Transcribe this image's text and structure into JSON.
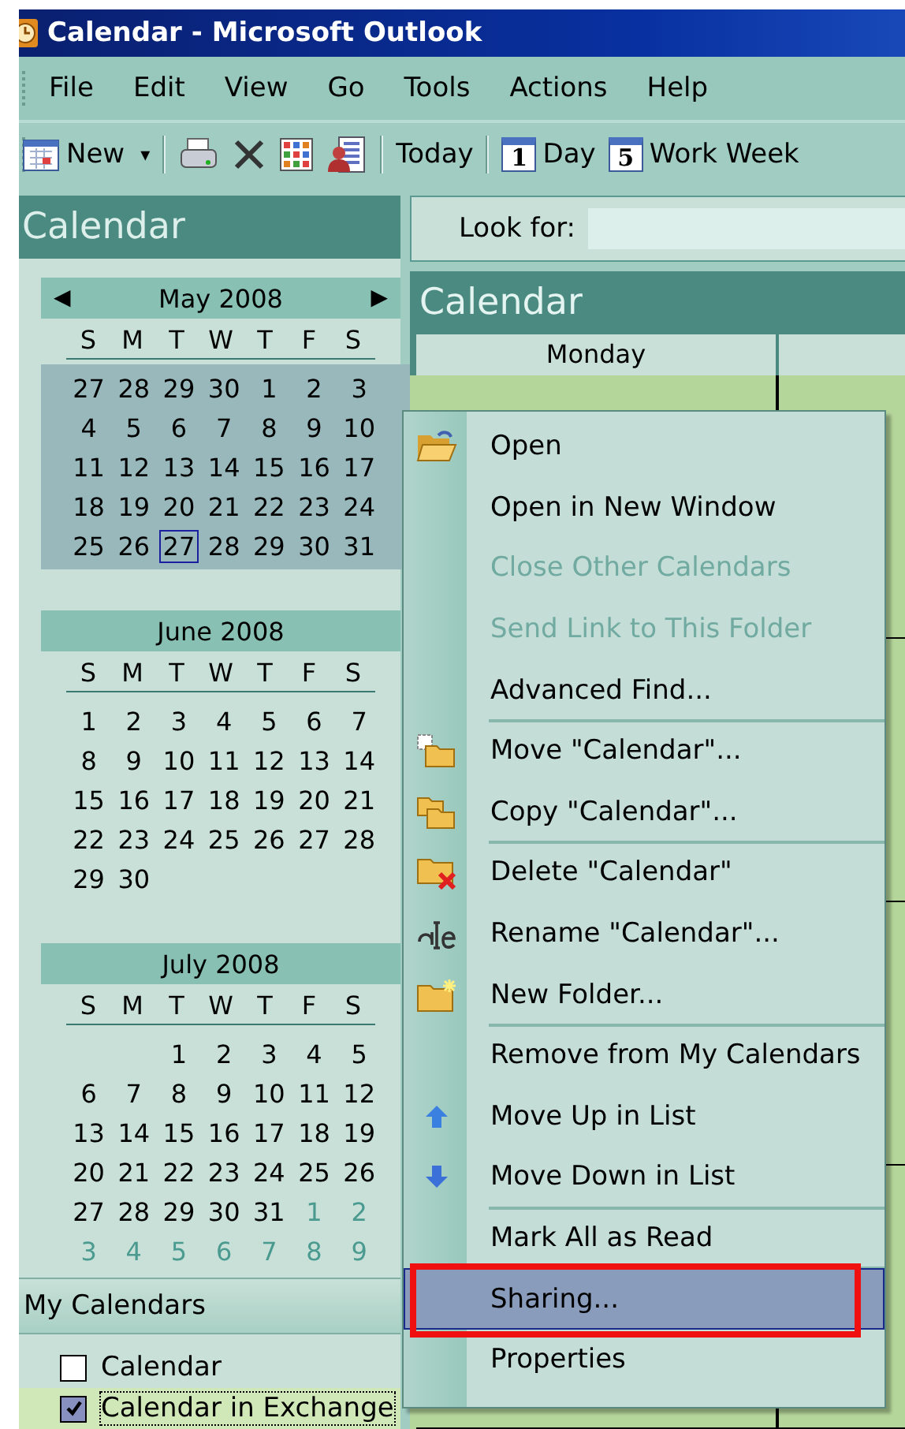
{
  "window": {
    "title": "Calendar - Microsoft Outlook"
  },
  "menu_bar": [
    "File",
    "Edit",
    "View",
    "Go",
    "Tools",
    "Actions",
    "Help"
  ],
  "toolbar": [
    {
      "kind": "new",
      "label": "New",
      "caret": "▾"
    },
    {
      "kind": "sep"
    },
    {
      "kind": "print"
    },
    {
      "kind": "delete"
    },
    {
      "kind": "grid"
    },
    {
      "kind": "contacts"
    },
    {
      "kind": "sep"
    },
    {
      "kind": "text",
      "label": "Today"
    },
    {
      "kind": "sep"
    },
    {
      "kind": "day",
      "glyph": "1",
      "label": "Day"
    },
    {
      "kind": "day",
      "glyph": "5",
      "label": "Work Week"
    }
  ],
  "navigation": {
    "title": "Calendar",
    "months": [
      {
        "title": "May 2008",
        "prev": "◀",
        "next": "▶",
        "selected": true,
        "weekdays": [
          "S",
          "M",
          "T",
          "W",
          "T",
          "F",
          "S"
        ],
        "weeks": [
          [
            "27",
            "28",
            "29",
            "30",
            "1",
            "2",
            "3"
          ],
          [
            "4",
            "5",
            "6",
            "7",
            "8",
            "9",
            "10"
          ],
          [
            "11",
            "12",
            "13",
            "14",
            "15",
            "16",
            "17"
          ],
          [
            "18",
            "19",
            "20",
            "21",
            "22",
            "23",
            "24"
          ],
          [
            "25",
            "26",
            {
              "d": "27",
              "today": true
            },
            "28",
            "29",
            "30",
            "31"
          ]
        ]
      },
      {
        "title": "June 2008",
        "selected": false,
        "weekdays": [
          "S",
          "M",
          "T",
          "W",
          "T",
          "F",
          "S"
        ],
        "weeks": [
          [
            "1",
            "2",
            "3",
            "4",
            "5",
            "6",
            "7"
          ],
          [
            "8",
            "9",
            "10",
            "11",
            "12",
            "13",
            "14"
          ],
          [
            "15",
            "16",
            "17",
            "18",
            "19",
            "20",
            "21"
          ],
          [
            "22",
            "23",
            "24",
            "25",
            "26",
            "27",
            "28"
          ],
          [
            "29",
            "30"
          ]
        ]
      },
      {
        "title": "July 2008",
        "selected": false,
        "weekdays": [
          "S",
          "M",
          "T",
          "W",
          "T",
          "F",
          "S"
        ],
        "weeks": [
          [
            "1",
            "2",
            "3",
            "4",
            "5"
          ],
          [
            "6",
            "7",
            "8",
            "9",
            "10",
            "11",
            "12"
          ],
          [
            "13",
            "14",
            "15",
            "16",
            "17",
            "18",
            "19"
          ],
          [
            "20",
            "21",
            "22",
            "23",
            "24",
            "25",
            "26"
          ],
          [
            "27",
            "28",
            "29",
            "30",
            "31"
          ]
        ],
        "next_month": [
          "1",
          "2",
          "3",
          "4",
          "5",
          "6",
          "7",
          "8",
          "9"
        ]
      }
    ],
    "section": "My Calendars",
    "calendars": [
      {
        "label": "Calendar",
        "checked": false,
        "selected": false
      },
      {
        "label": "Calendar in Exchange",
        "checked": true,
        "selected": true
      }
    ]
  },
  "search": {
    "label": "Look for:"
  },
  "view": {
    "title": "Calendar",
    "columns": [
      "Monday"
    ]
  },
  "context_menu": [
    {
      "label": "Open",
      "kind": "open",
      "disabled": false,
      "selected": false,
      "separator_before": false,
      "annotated": false
    },
    {
      "label": "Open in New Window",
      "kind": "plain",
      "disabled": false,
      "selected": false,
      "separator_before": false,
      "annotated": false
    },
    {
      "label": "Close Other Calendars",
      "kind": "plain",
      "disabled": true,
      "selected": false,
      "separator_before": false,
      "annotated": false
    },
    {
      "label": "Send Link to This Folder",
      "kind": "plain",
      "disabled": true,
      "selected": false,
      "separator_before": false,
      "annotated": false
    },
    {
      "label": "Advanced Find...",
      "kind": "plain",
      "disabled": false,
      "selected": false,
      "separator_before": false,
      "annotated": false
    },
    {
      "label": "Move \"Calendar\"...",
      "kind": "move",
      "disabled": false,
      "selected": false,
      "separator_before": true,
      "annotated": false
    },
    {
      "label": "Copy \"Calendar\"...",
      "kind": "copy",
      "disabled": false,
      "selected": false,
      "separator_before": false,
      "annotated": false
    },
    {
      "label": "Delete \"Calendar\"",
      "kind": "delete",
      "disabled": false,
      "selected": false,
      "separator_before": true,
      "annotated": false
    },
    {
      "label": "Rename \"Calendar\"...",
      "kind": "rename",
      "disabled": false,
      "selected": false,
      "separator_before": false,
      "annotated": false
    },
    {
      "label": "New Folder...",
      "kind": "newfolder",
      "disabled": false,
      "selected": false,
      "separator_before": false,
      "annotated": false
    },
    {
      "label": "Remove from My Calendars",
      "kind": "plain",
      "disabled": false,
      "selected": false,
      "separator_before": true,
      "annotated": false
    },
    {
      "label": "Move Up in List",
      "kind": "up",
      "disabled": false,
      "selected": false,
      "separator_before": false,
      "annotated": false
    },
    {
      "label": "Move Down in List",
      "kind": "down",
      "disabled": false,
      "selected": false,
      "separator_before": false,
      "annotated": false
    },
    {
      "label": "Mark All as Read",
      "kind": "plain",
      "disabled": false,
      "selected": false,
      "separator_before": true,
      "annotated": false
    },
    {
      "label": "Sharing...",
      "kind": "plain",
      "disabled": false,
      "selected": true,
      "separator_before": true,
      "annotated": true
    },
    {
      "label": "Properties",
      "kind": "plain",
      "disabled": false,
      "selected": false,
      "separator_before": false,
      "annotated": false
    }
  ]
}
